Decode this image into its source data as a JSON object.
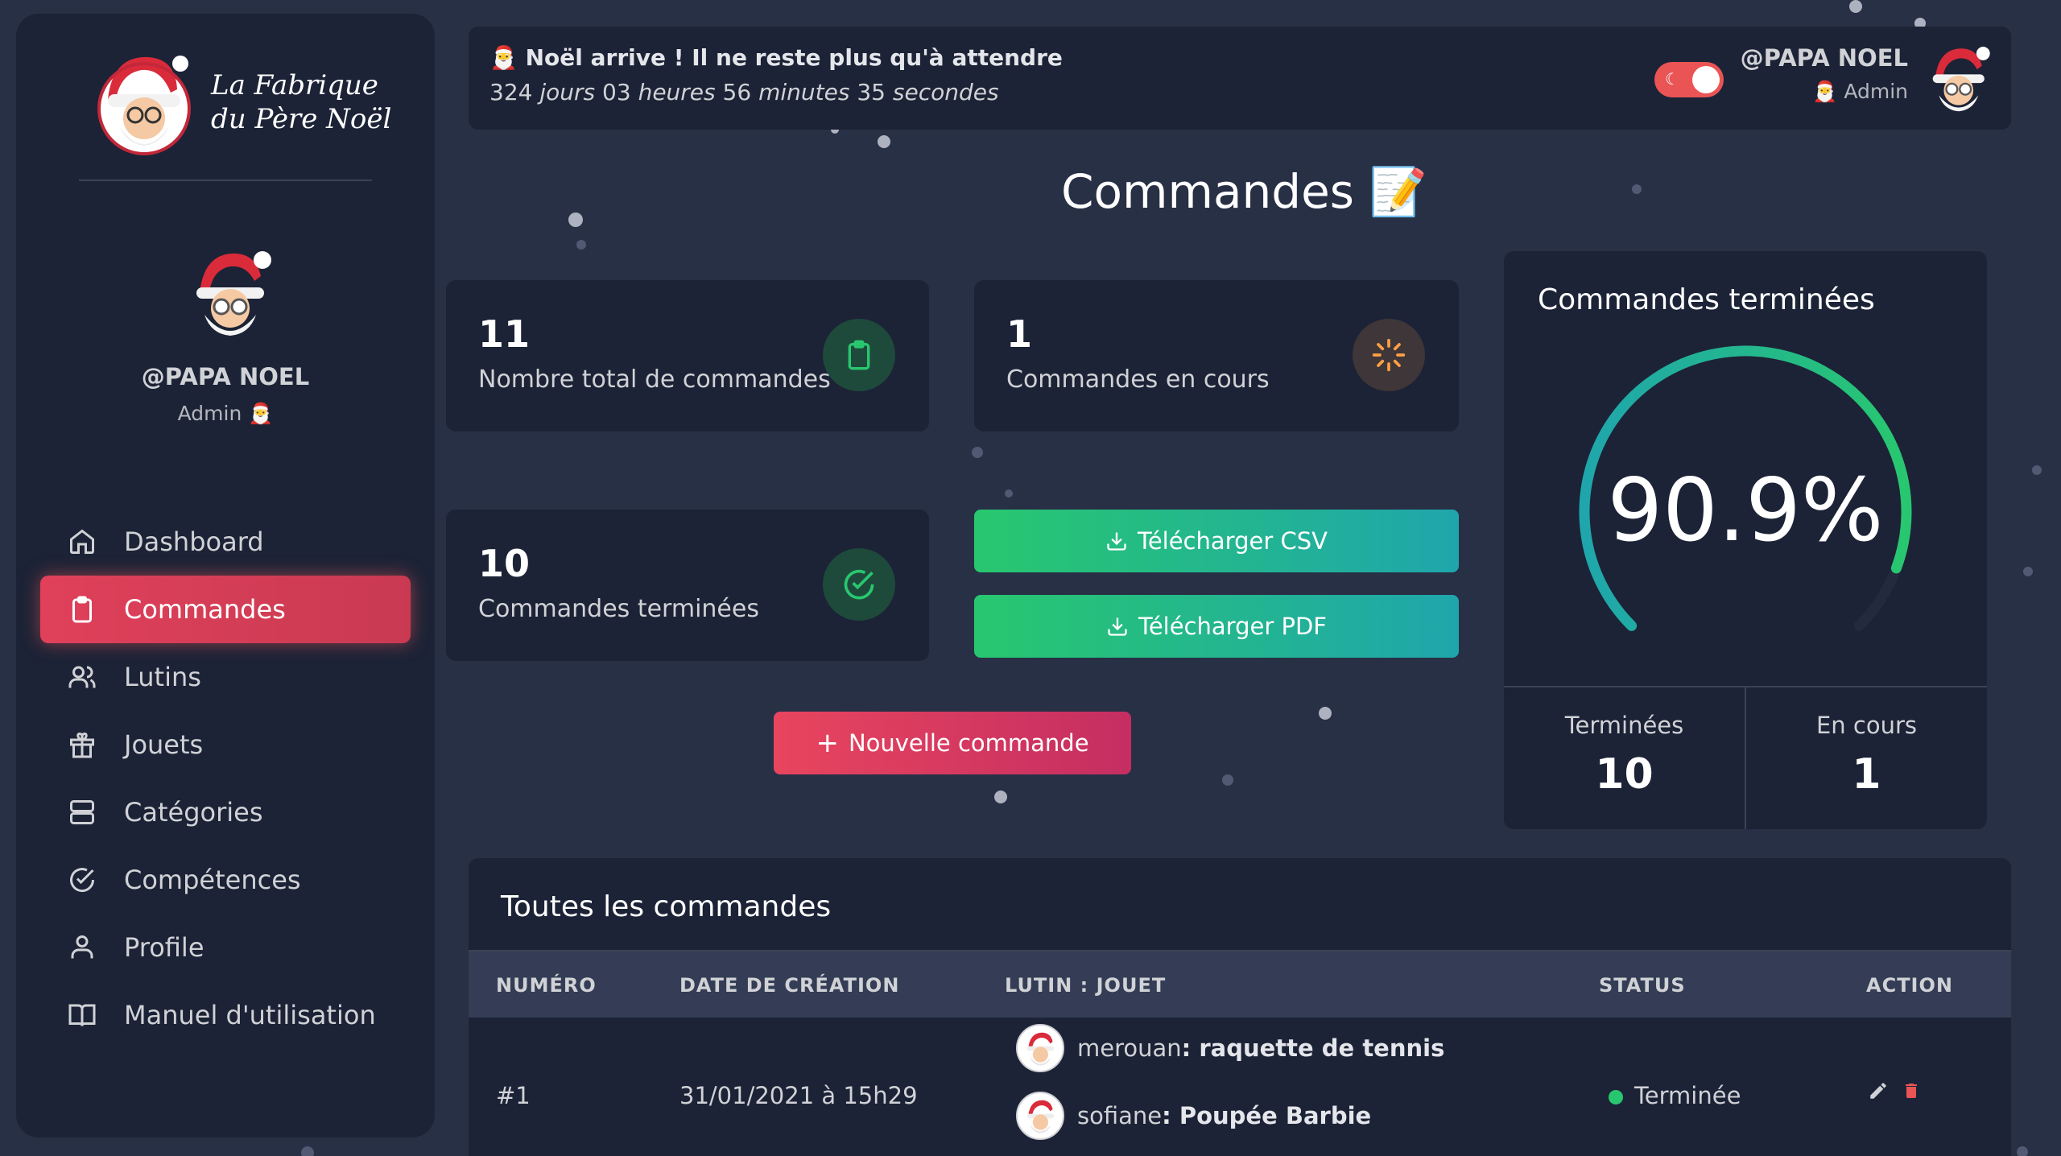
{
  "brand": {
    "line1": "La Fabrique",
    "line2": "du Père Noël"
  },
  "profile": {
    "name": "@PAPA NOEL",
    "role": "Admin"
  },
  "nav": [
    {
      "label": "Dashboard",
      "icon": "home-icon"
    },
    {
      "label": "Commandes",
      "icon": "clipboard-icon",
      "active": true
    },
    {
      "label": "Lutins",
      "icon": "users-icon"
    },
    {
      "label": "Jouets",
      "icon": "gift-icon"
    },
    {
      "label": "Catégories",
      "icon": "server-icon"
    },
    {
      "label": "Compétences",
      "icon": "check-circle-icon"
    },
    {
      "label": "Profile",
      "icon": "user-icon"
    },
    {
      "label": "Manuel d'utilisation",
      "icon": "book-icon"
    }
  ],
  "header": {
    "countdown_title": "Noël arrive ! Il ne reste plus qu'à attendre",
    "days": "324",
    "days_label": "jours",
    "hours": "03",
    "hours_label": "heures",
    "minutes": "56",
    "minutes_label": "minutes",
    "seconds": "35",
    "seconds_label": "secondes",
    "user_name": "@PAPA NOEL",
    "user_role": "Admin"
  },
  "page_title": "Commandes",
  "stats": {
    "total": {
      "value": "11",
      "label": "Nombre total de commandes"
    },
    "in_progress": {
      "value": "1",
      "label": "Commandes en cours"
    },
    "done": {
      "value": "10",
      "label": "Commandes terminées"
    }
  },
  "buttons": {
    "csv": "Télécharger CSV",
    "pdf": "Télécharger PDF",
    "new_order": "Nouvelle commande"
  },
  "gauge": {
    "title": "Commandes terminées",
    "value": "90.9%",
    "fraction": 0.909,
    "left_label": "Terminées",
    "left_value": "10",
    "right_label": "En cours",
    "right_value": "1"
  },
  "table": {
    "title": "Toutes les commandes",
    "headers": [
      "NUMÉRO",
      "DATE DE CRÉATION",
      "LUTIN : JOUET",
      "STATUS",
      "ACTION"
    ],
    "rows": [
      {
        "number": "#1",
        "date": "31/01/2021 à 15h29",
        "items": [
          {
            "elf": "merouan",
            "toy": "raquette de tennis"
          },
          {
            "elf": "sofiane",
            "toy": "Poupée Barbie"
          }
        ],
        "status": "Terminée"
      }
    ]
  },
  "colors": {
    "accent_red": "#ea5455",
    "success_green": "#28c76f",
    "warning_orange": "#ff9f43",
    "gauge_start": "#1fa6ac",
    "gauge_end": "#28c76f"
  }
}
